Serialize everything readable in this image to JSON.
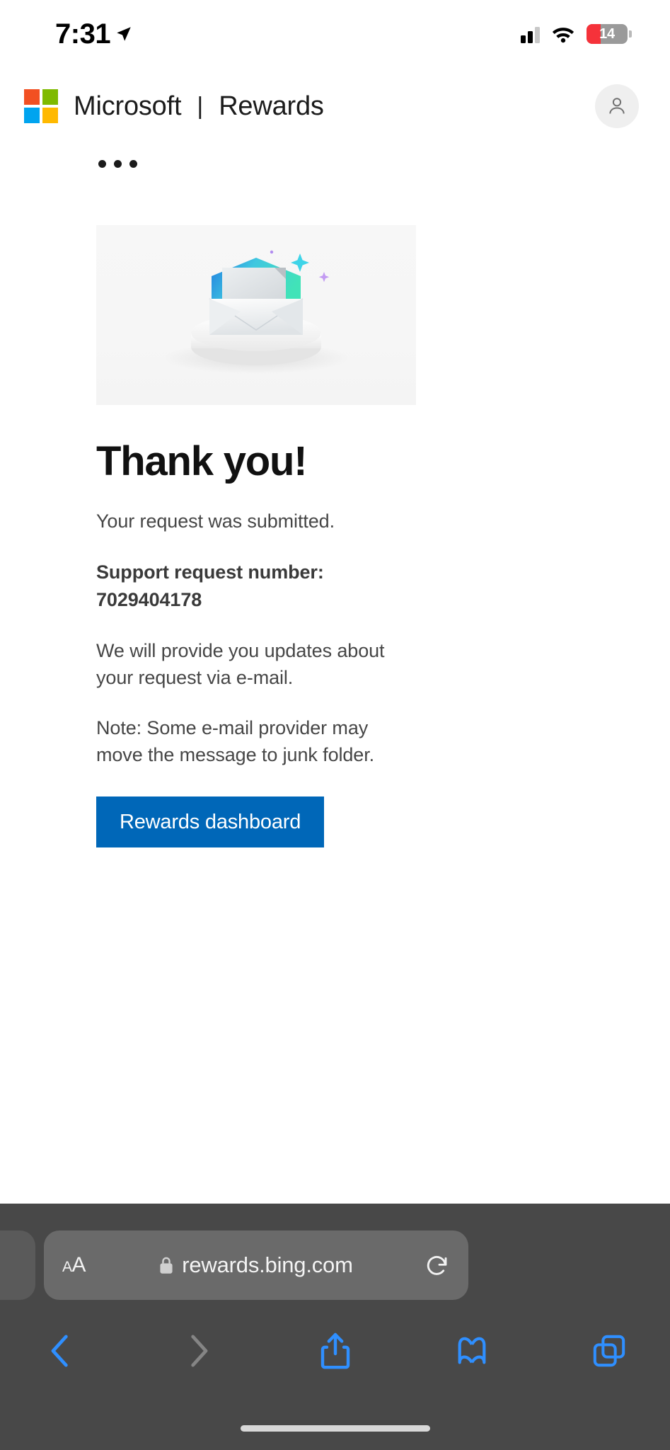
{
  "status_bar": {
    "time": "7:31",
    "location_icon": "location-arrow-icon",
    "cellular_icon": "cellular-bars-icon",
    "wifi_icon": "wifi-icon",
    "battery_percent": "14",
    "battery_color": "#f5323a"
  },
  "header": {
    "logo_icon": "microsoft-logo-icon",
    "brand": "Microsoft",
    "separator": "|",
    "product": "Rewards",
    "avatar_icon": "account-avatar-icon"
  },
  "overflow_menu": {
    "icon": "ellipsis-icon",
    "label": "..."
  },
  "hero": {
    "illustration_name": "open-envelope-on-podium-illustration",
    "background": "#f6f6f6",
    "sparkle_color": "#3ed4e8",
    "dot_color": "#b18cf0"
  },
  "main": {
    "title": "Thank you!",
    "submitted_text": "Your request was submitted.",
    "request_label": "Support request number: 7029404178",
    "updates_text": "We will provide you updates about your request via e-mail.",
    "note_text": "Note: Some e-mail provider may move the message to junk folder.",
    "cta_label": "Rewards dashboard",
    "cta_color": "#0067b8"
  },
  "browser": {
    "text_size_label": "AA",
    "lock_icon": "lock-icon",
    "url": "rewards.bing.com",
    "reload_icon": "reload-icon",
    "toolbar": [
      {
        "name": "back-button",
        "icon": "chevron-left-icon",
        "enabled": true
      },
      {
        "name": "forward-button",
        "icon": "chevron-right-icon",
        "enabled": false
      },
      {
        "name": "share-button",
        "icon": "share-icon",
        "enabled": true
      },
      {
        "name": "bookmarks-button",
        "icon": "book-icon",
        "enabled": true
      },
      {
        "name": "tabs-button",
        "icon": "tabs-icon",
        "enabled": true
      }
    ],
    "accent_color": "#2f8fff",
    "bar_color": "#484848"
  }
}
